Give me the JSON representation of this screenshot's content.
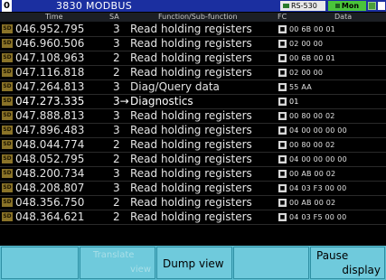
{
  "titlebar": {
    "number": "0",
    "title": "3830  MODBUS",
    "port": "RS-530",
    "mode": "Mon"
  },
  "columns": {
    "time": "Time",
    "sa": "SA",
    "function": "Function/Sub-function",
    "fc": "FC",
    "data": "Data"
  },
  "rows": [
    {
      "tag": "SD",
      "time": "046.952.795",
      "sa": "3",
      "fn": "Read holding registers",
      "data": "00 6B 00 01"
    },
    {
      "tag": "SD",
      "time": "046.960.506",
      "sa": "3",
      "fn": "Read holding registers",
      "data": "02 00 00"
    },
    {
      "tag": "SD",
      "time": "047.108.963",
      "sa": "2",
      "fn": "Read holding registers",
      "data": "00 6B 00 01"
    },
    {
      "tag": "SD",
      "time": "047.116.818",
      "sa": "2",
      "fn": "Read holding registers",
      "data": "02 00 00"
    },
    {
      "tag": "SD",
      "time": "047.264.813",
      "sa": "3",
      "fn": "Diag/Query data",
      "data": "55 AA"
    },
    {
      "tag": "SD",
      "time": "047.273.335",
      "sa": "3→",
      "fn": "Diagnostics",
      "data": "01"
    },
    {
      "tag": "SD",
      "time": "047.888.813",
      "sa": "3",
      "fn": "Read holding registers",
      "data": "00 80 00 02"
    },
    {
      "tag": "SD",
      "time": "047.896.483",
      "sa": "3",
      "fn": "Read holding registers",
      "data": "04 00 00 00 00"
    },
    {
      "tag": "SD",
      "time": "048.044.774",
      "sa": "2",
      "fn": "Read holding registers",
      "data": "00 80 00 02"
    },
    {
      "tag": "SD",
      "time": "048.052.795",
      "sa": "2",
      "fn": "Read holding registers",
      "data": "04 00 00 00 00"
    },
    {
      "tag": "SD",
      "time": "048.200.734",
      "sa": "3",
      "fn": "Read holding registers",
      "data": "00 AB 00 02"
    },
    {
      "tag": "SD",
      "time": "048.208.807",
      "sa": "3",
      "fn": "Read holding registers",
      "data": "04 03 F3 00 00"
    },
    {
      "tag": "SD",
      "time": "048.356.750",
      "sa": "2",
      "fn": "Read holding registers",
      "data": "00 AB 00 02"
    },
    {
      "tag": "SD",
      "time": "048.364.621",
      "sa": "2",
      "fn": "Read holding registers",
      "data": "04 03 F5 00 00"
    }
  ],
  "fc_icon": "fc-icon",
  "softkeys": {
    "k1": "",
    "k2a": "Translate",
    "k2b": "view",
    "k3": "Dump view",
    "k4": "",
    "k5a": "Pause",
    "k5b": "display"
  },
  "colors": {
    "title_bar": "#1b2fa0",
    "mon_badge": "#4ac43a",
    "softkey_bar": "#5fbfd2",
    "sd_tag": "#8a7328"
  }
}
